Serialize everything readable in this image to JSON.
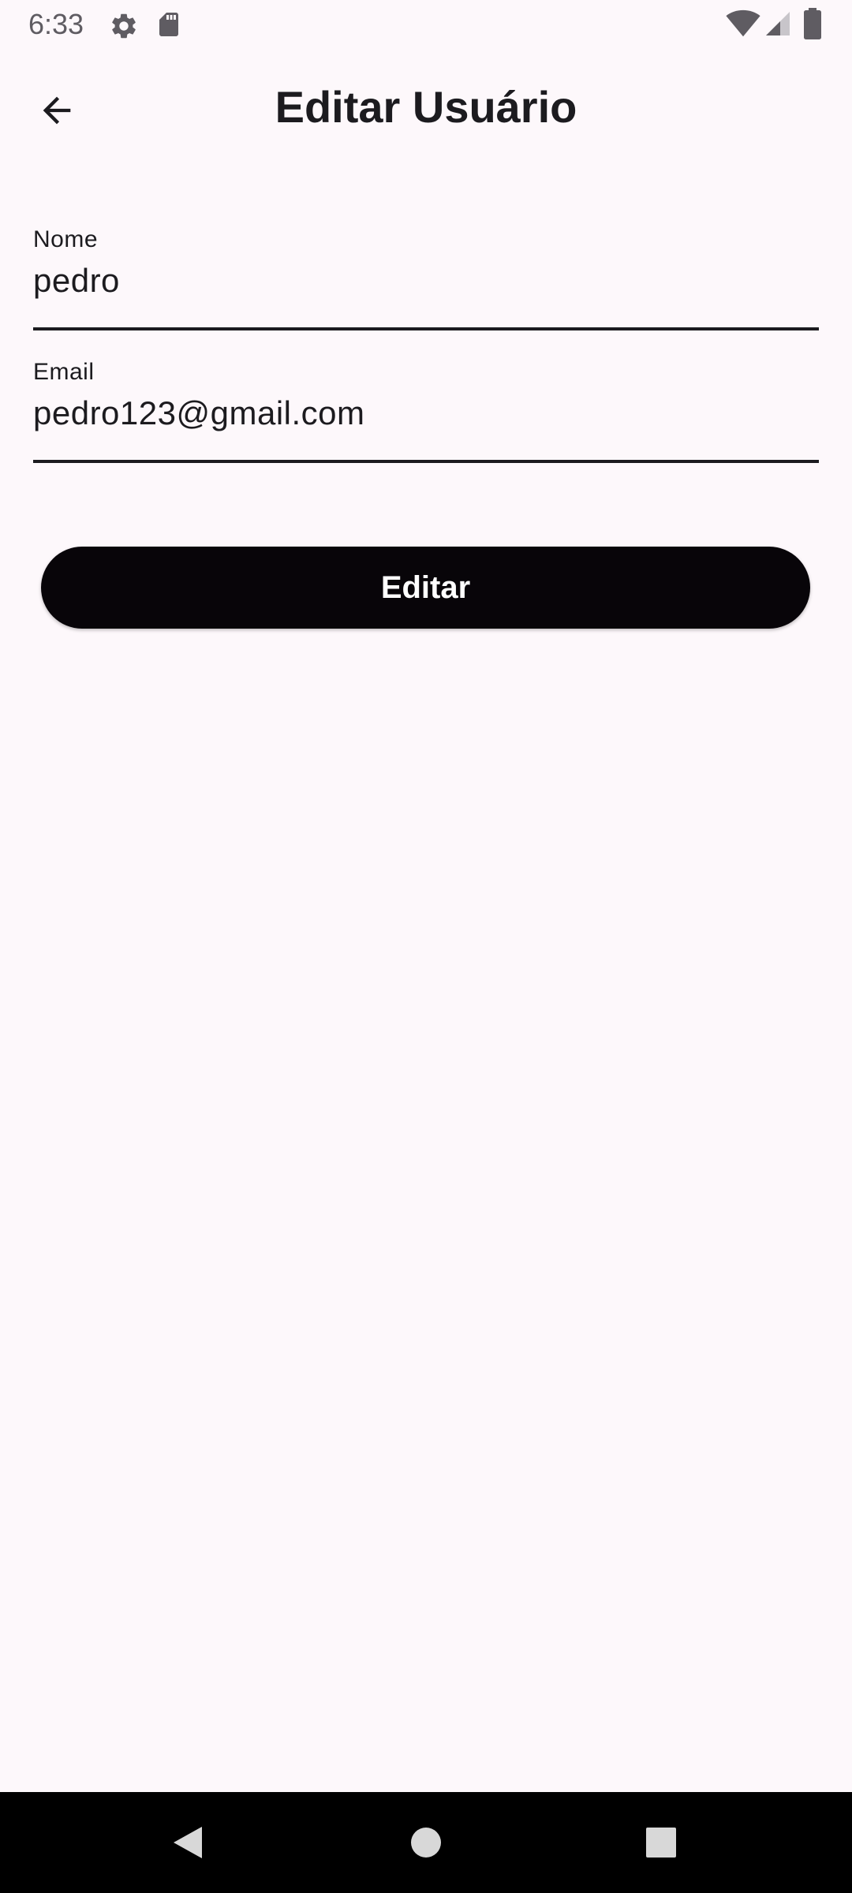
{
  "status_bar": {
    "time": "6:33",
    "icons": [
      "gear-icon",
      "sd-card-icon",
      "wifi-icon",
      "cellular-signal-icon",
      "battery-icon"
    ]
  },
  "app_bar": {
    "back_icon": "arrow-back-icon",
    "title": "Editar Usuário"
  },
  "form": {
    "name": {
      "label": "Nome",
      "value": "pedro"
    },
    "email": {
      "label": "Email",
      "value": "pedro123@gmail.com"
    },
    "submit_label": "Editar"
  },
  "nav_bar": {
    "icons": [
      "nav-back-icon",
      "nav-home-icon",
      "nav-recents-icon"
    ]
  },
  "colors": {
    "background": "#FDF8FB",
    "button": "#080509",
    "button_text": "#FFFFFF",
    "text": "#1C1B1F",
    "nav_bar": "#000000"
  }
}
